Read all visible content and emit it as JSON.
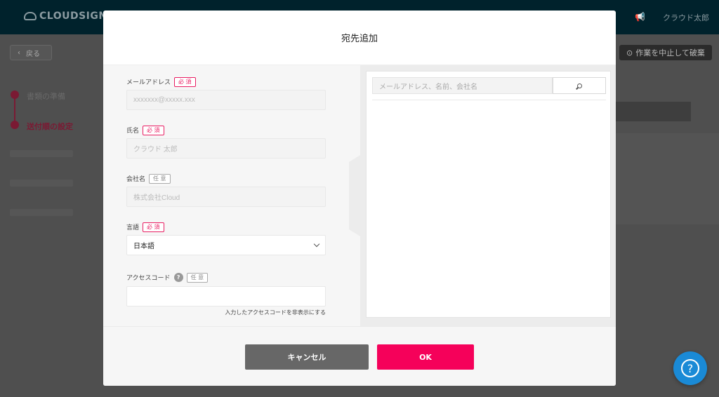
{
  "app": {
    "logo_text": "CLOUDSIGN",
    "user_name": "クラウド太郎",
    "back_label": "戻る",
    "abort_label": "作業を中止して破棄",
    "steps": [
      {
        "label": "書類の準備"
      },
      {
        "label": "送付順の設定"
      }
    ]
  },
  "modal": {
    "title": "宛先追加",
    "fields": {
      "email": {
        "label": "メールアドレス",
        "badge": "必 須",
        "placeholder": "xxxxxxx@xxxxx.xxx"
      },
      "name": {
        "label": "氏名",
        "badge": "必 須",
        "placeholder": "クラウド 太郎"
      },
      "company": {
        "label": "会社名",
        "badge": "任 意",
        "placeholder": "株式会社Cloud"
      },
      "language": {
        "label": "言語",
        "badge": "必 須",
        "value": "日本語"
      },
      "access_code": {
        "label": "アクセスコード",
        "badge": "任 意",
        "info_icon": "?",
        "hide_link": "入力したアクセスコードを非表示にする"
      }
    },
    "search": {
      "placeholder": "メールアドレス、名前、会社名"
    },
    "cancel_label": "キャンセル",
    "ok_label": "OK"
  },
  "help": {
    "icon": "?"
  },
  "colors": {
    "accent": "#f5015a",
    "required": "#e91e63",
    "help": "#1a8ad6",
    "topbar": "#00222c"
  }
}
